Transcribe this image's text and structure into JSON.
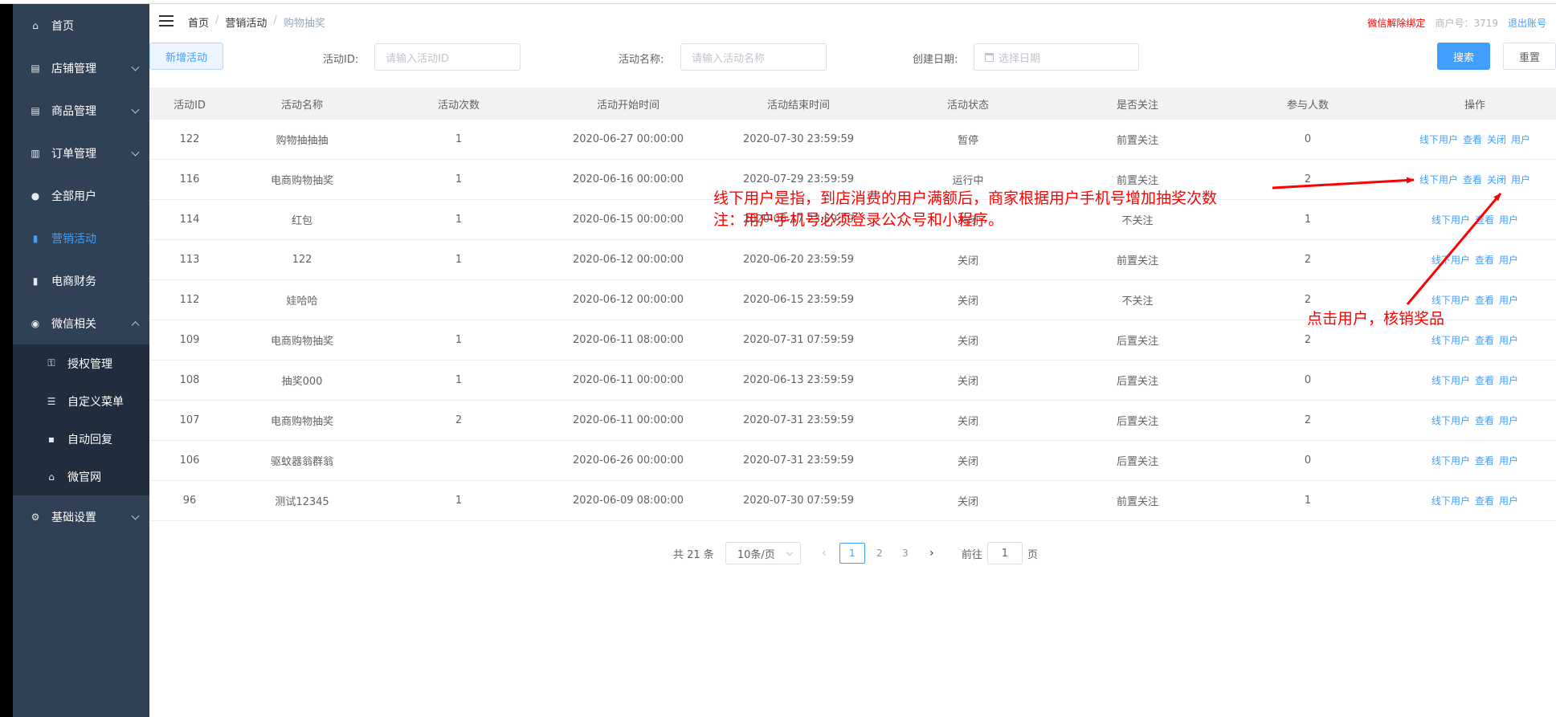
{
  "sidebar": {
    "items": [
      {
        "label": "首页",
        "icon": "home-icon",
        "glyph": "⌂",
        "chevron": false,
        "active": false
      },
      {
        "label": "店铺管理",
        "icon": "store-icon",
        "glyph": "▤",
        "chevron": true,
        "active": false
      },
      {
        "label": "商品管理",
        "icon": "goods-icon",
        "glyph": "▤",
        "chevron": true,
        "active": false
      },
      {
        "label": "订单管理",
        "icon": "order-icon",
        "glyph": "▥",
        "chevron": true,
        "active": false
      },
      {
        "label": "全部用户",
        "icon": "users-icon",
        "glyph": "●",
        "chevron": false,
        "active": false
      },
      {
        "label": "营销活动",
        "icon": "chart-icon",
        "glyph": "▮",
        "chevron": false,
        "active": true
      },
      {
        "label": "电商财务",
        "icon": "finance-icon",
        "glyph": "▮",
        "chevron": false,
        "active": false
      },
      {
        "label": "微信相关",
        "icon": "wechat-icon",
        "glyph": "◉",
        "chevron": true,
        "active": false,
        "expanded": true
      }
    ],
    "subitems": [
      {
        "label": "授权管理",
        "icon": "key-icon",
        "glyph": "⚿"
      },
      {
        "label": "自定义菜单",
        "icon": "list-icon",
        "glyph": "☰"
      },
      {
        "label": "自动回复",
        "icon": "message-icon",
        "glyph": "▪"
      },
      {
        "label": "微官网",
        "icon": "home-icon",
        "glyph": "⌂"
      }
    ],
    "footer_item": {
      "label": "基础设置",
      "icon": "gear-icon",
      "glyph": "⚙"
    }
  },
  "breadcrumb": [
    "首页",
    "营销活动",
    "购物抽奖"
  ],
  "header_right": {
    "unbind": "微信解除绑定",
    "merchant": "商户号：3719",
    "logout": "退出账号"
  },
  "toolbar": {
    "new_label": "新增活动",
    "id_label": "活动ID:",
    "id_placeholder": "请输入活动ID",
    "name_label": "活动名称:",
    "name_placeholder": "请输入活动名称",
    "date_label": "创建日期:",
    "date_placeholder": "选择日期",
    "search_label": "搜索",
    "reset_label": "重置"
  },
  "table": {
    "headers": [
      "活动ID",
      "活动名称",
      "活动次数",
      "活动开始时间",
      "活动结束时间",
      "活动状态",
      "是否关注",
      "参与人数",
      "操作"
    ],
    "rows": [
      {
        "id": "122",
        "name": "购物抽抽抽",
        "count": "1",
        "start": "2020-06-27 00:00:00",
        "end": "2020-07-30 23:59:59",
        "status": "暂停",
        "follow": "前置关注",
        "people": "0",
        "ops": [
          "线下用户",
          "查看",
          "关闭",
          "用户"
        ]
      },
      {
        "id": "116",
        "name": "电商购物抽奖",
        "count": "1",
        "start": "2020-06-16 00:00:00",
        "end": "2020-07-29 23:59:59",
        "status": "运行中",
        "follow": "前置关注",
        "people": "2",
        "ops": [
          "线下用户",
          "查看",
          "关闭",
          "用户"
        ]
      },
      {
        "id": "114",
        "name": "红包",
        "count": "1",
        "start": "2020-06-15 00:00:00",
        "end": "2020-06-17 23:59:59",
        "status": "关闭",
        "follow": "不关注",
        "people": "1",
        "ops": [
          "线下用户",
          "查看",
          "用户"
        ]
      },
      {
        "id": "113",
        "name": "122",
        "count": "1",
        "start": "2020-06-12 00:00:00",
        "end": "2020-06-20 23:59:59",
        "status": "关闭",
        "follow": "前置关注",
        "people": "2",
        "ops": [
          "线下用户",
          "查看",
          "用户"
        ]
      },
      {
        "id": "112",
        "name": "娃哈哈",
        "count": "",
        "start": "2020-06-12 00:00:00",
        "end": "2020-06-15 23:59:59",
        "status": "关闭",
        "follow": "不关注",
        "people": "2",
        "ops": [
          "线下用户",
          "查看",
          "用户"
        ]
      },
      {
        "id": "109",
        "name": "电商购物抽奖",
        "count": "1",
        "start": "2020-06-11 08:00:00",
        "end": "2020-07-31 07:59:59",
        "status": "关闭",
        "follow": "后置关注",
        "people": "2",
        "ops": [
          "线下用户",
          "查看",
          "用户"
        ]
      },
      {
        "id": "108",
        "name": "抽奖000",
        "count": "1",
        "start": "2020-06-11 00:00:00",
        "end": "2020-06-13 23:59:59",
        "status": "关闭",
        "follow": "后置关注",
        "people": "0",
        "ops": [
          "线下用户",
          "查看",
          "用户"
        ]
      },
      {
        "id": "107",
        "name": "电商购物抽奖",
        "count": "2",
        "start": "2020-06-11 00:00:00",
        "end": "2020-07-31 23:59:59",
        "status": "关闭",
        "follow": "后置关注",
        "people": "2",
        "ops": [
          "线下用户",
          "查看",
          "用户"
        ]
      },
      {
        "id": "106",
        "name": "驱蚊器翁群翁",
        "count": "",
        "start": "2020-06-26 00:00:00",
        "end": "2020-07-31 23:59:59",
        "status": "关闭",
        "follow": "后置关注",
        "people": "0",
        "ops": [
          "线下用户",
          "查看",
          "用户"
        ]
      },
      {
        "id": "96",
        "name": "测试12345",
        "count": "1",
        "start": "2020-06-09 08:00:00",
        "end": "2020-07-30 07:59:59",
        "status": "关闭",
        "follow": "前置关注",
        "people": "1",
        "ops": [
          "线下用户",
          "查看",
          "用户"
        ]
      }
    ]
  },
  "pagination": {
    "total": "共 21 条",
    "page_size": "10条/页",
    "pages": [
      "1",
      "2",
      "3"
    ],
    "current": "1",
    "goto_label": "前往",
    "goto_value": "1",
    "page_unit": "页"
  },
  "annotations": {
    "line1": "线下用户是指，到店消费的用户满额后，商家根据用户手机号增加抽奖次数",
    "line2": "注：用户手机号必须登录公众号和小程序。",
    "line3": "点击用户，核销奖品",
    "color": "#ff0000"
  },
  "colors": {
    "sidebar": "#304156",
    "submenu": "#1f2d3d",
    "accent": "#409eff"
  }
}
